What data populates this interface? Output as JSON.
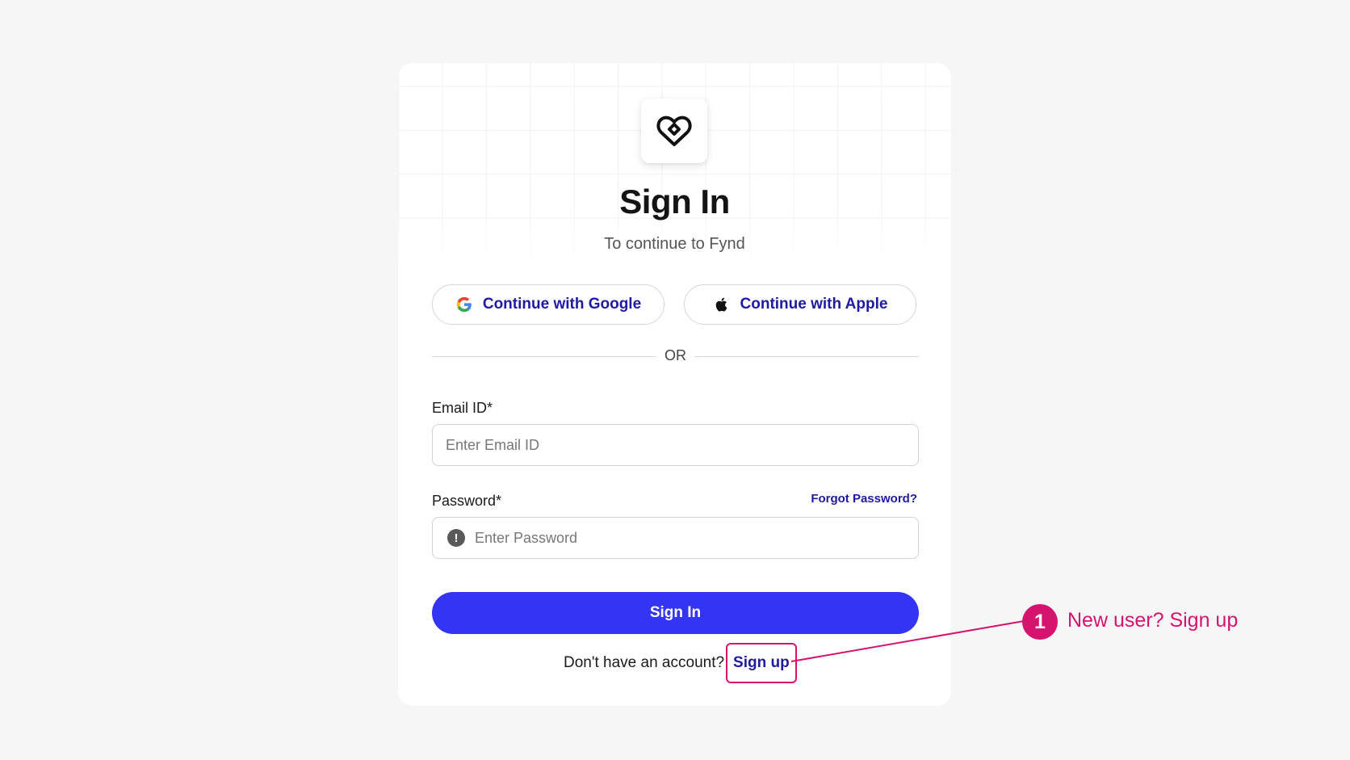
{
  "signin": {
    "title": "Sign In",
    "subtitle": "To continue to Fynd",
    "oauth": {
      "google": "Continue with Google",
      "apple": "Continue with Apple"
    },
    "divider_text": "OR",
    "email": {
      "label": "Email ID*",
      "placeholder": "Enter Email ID"
    },
    "password": {
      "label": "Password*",
      "placeholder": "Enter Password",
      "forgot": "Forgot Password?"
    },
    "submit": "Sign In",
    "signup": {
      "prompt": "Don't have an account?",
      "link": "Sign up"
    }
  },
  "annotation": {
    "number": "1",
    "text": "New user? Sign up",
    "color": "#d4146e"
  },
  "colors": {
    "primary": "#3434f5",
    "link": "#1f1aa1",
    "background": "#f6f6f6"
  },
  "icons": {
    "logo": "heart-link-logo",
    "google": "google-icon",
    "apple": "apple-icon",
    "password_alert": "alert-circle-icon"
  }
}
